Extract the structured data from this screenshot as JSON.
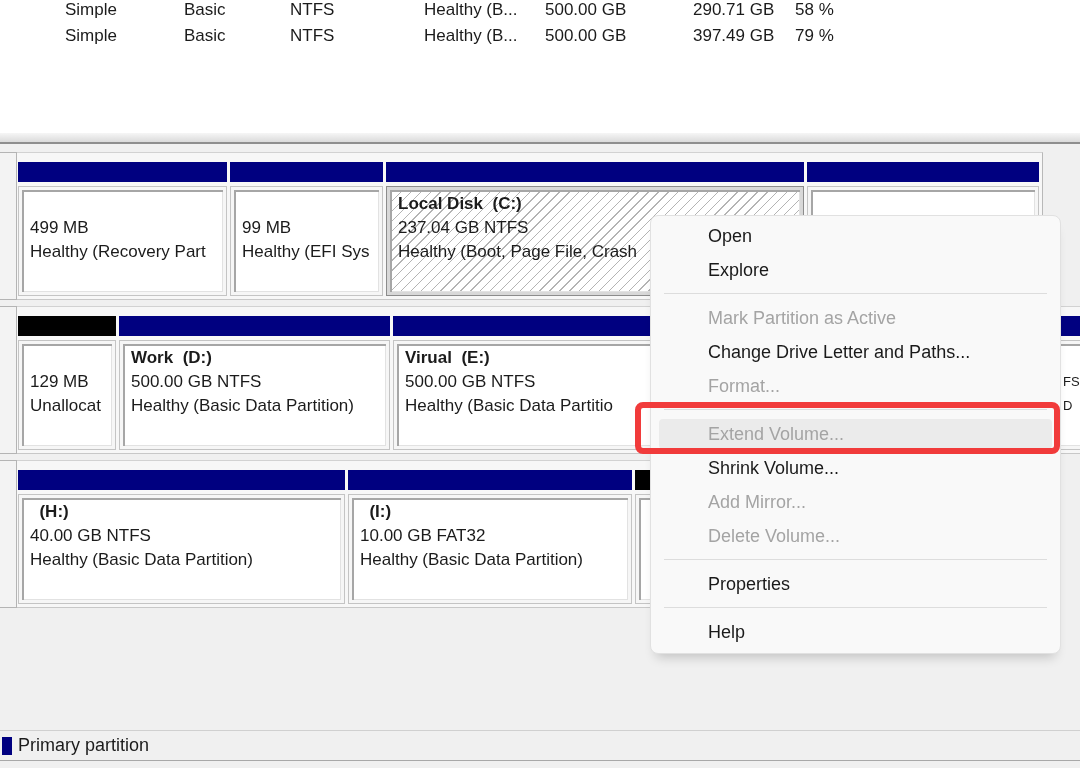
{
  "volume_list": {
    "rows": [
      [
        "Simple",
        "Basic",
        "NTFS",
        "Healthy (B...",
        "500.00 GB",
        "290.71 GB",
        "58 %"
      ],
      [
        "Simple",
        "Basic",
        "NTFS",
        "Healthy (B...",
        "500.00 GB",
        "397.49 GB",
        "79 %"
      ]
    ]
  },
  "disks": [
    {
      "partitions": [
        {
          "kind": "primary",
          "selected": false,
          "size": "499 MB",
          "status": "Healthy (Recovery Part"
        },
        {
          "kind": "primary",
          "selected": false,
          "size": "99 MB",
          "status": "Healthy (EFI Sys"
        },
        {
          "kind": "primary",
          "selected": true,
          "label": "Local Disk  (C:)",
          "size": "237.04 GB NTFS",
          "status": "Healthy (Boot, Page File, Crash"
        },
        {
          "kind": "primary",
          "selected": false
        }
      ]
    },
    {
      "partitions": [
        {
          "kind": "unallocated",
          "selected": false,
          "size": "129 MB",
          "status": "Unallocat"
        },
        {
          "kind": "primary",
          "selected": false,
          "label": "Work  (D:)",
          "size": "500.00 GB NTFS",
          "status": "Healthy (Basic Data Partition)"
        },
        {
          "kind": "primary",
          "selected": false,
          "label": "Virual  (E:)",
          "size": "500.00 GB NTFS",
          "status": "Healthy (Basic Data Partitio"
        },
        {
          "kind": "primary",
          "selected": false,
          "size": "FS",
          "status": "D"
        }
      ]
    },
    {
      "partitions": [
        {
          "kind": "primary",
          "selected": false,
          "label": "  (H:)",
          "size": "40.00 GB NTFS",
          "status": "Healthy (Basic Data Partition)"
        },
        {
          "kind": "primary",
          "selected": false,
          "label": "  (I:)",
          "size": "10.00 GB FAT32",
          "status": "Healthy (Basic Data Partition)"
        },
        {
          "kind": "unallocated",
          "selected": false
        }
      ]
    }
  ],
  "context_menu": {
    "items": [
      {
        "kind": "item",
        "label": "Open",
        "disabled": false,
        "hovered": false,
        "annotated": false
      },
      {
        "kind": "item",
        "label": "Explore",
        "disabled": false,
        "hovered": false,
        "annotated": false
      },
      {
        "kind": "separator"
      },
      {
        "kind": "item",
        "label": "Mark Partition as Active",
        "disabled": true,
        "hovered": false,
        "annotated": false
      },
      {
        "kind": "item",
        "label": "Change Drive Letter and Paths...",
        "disabled": false,
        "hovered": false,
        "annotated": false
      },
      {
        "kind": "item",
        "label": "Format...",
        "disabled": true,
        "hovered": false,
        "annotated": false
      },
      {
        "kind": "separator"
      },
      {
        "kind": "item",
        "label": "Extend Volume...",
        "disabled": true,
        "hovered": true,
        "annotated": true
      },
      {
        "kind": "item",
        "label": "Shrink Volume...",
        "disabled": false,
        "hovered": false,
        "annotated": false
      },
      {
        "kind": "item",
        "label": "Add Mirror...",
        "disabled": true,
        "hovered": false,
        "annotated": false
      },
      {
        "kind": "item",
        "label": "Delete Volume...",
        "disabled": true,
        "hovered": false,
        "annotated": false
      },
      {
        "kind": "separator"
      },
      {
        "kind": "item",
        "label": "Properties",
        "disabled": false,
        "hovered": false,
        "annotated": false
      },
      {
        "kind": "separator"
      },
      {
        "kind": "item",
        "label": "Help",
        "disabled": false,
        "hovered": false,
        "annotated": false
      }
    ]
  },
  "legend": [
    {
      "kind": "primary",
      "label": "Primary partition"
    }
  ]
}
